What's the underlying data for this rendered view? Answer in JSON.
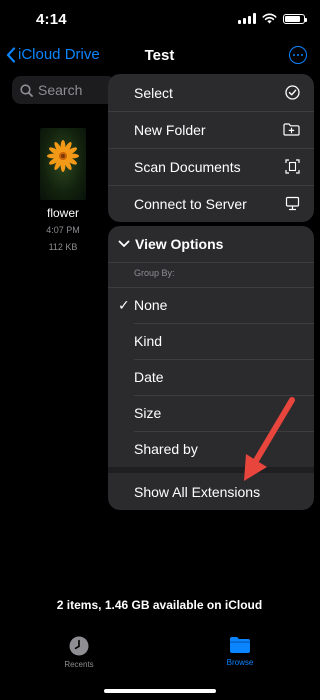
{
  "status_bar": {
    "time": "4:14"
  },
  "nav": {
    "back_label": "iCloud Drive",
    "title": "Test"
  },
  "search": {
    "placeholder": "Search"
  },
  "file": {
    "name": "flower",
    "time": "4:07 PM",
    "size": "112 KB"
  },
  "menu": {
    "actions": [
      {
        "label": "Select",
        "icon": "checkmark-circle-icon"
      },
      {
        "label": "New Folder",
        "icon": "folder-plus-icon"
      },
      {
        "label": "Scan Documents",
        "icon": "document-scan-icon"
      },
      {
        "label": "Connect to Server",
        "icon": "monitor-icon"
      }
    ],
    "view_options": {
      "title": "View Options",
      "group_by_label": "Group By:",
      "options": [
        "None",
        "Kind",
        "Date",
        "Size",
        "Shared by"
      ],
      "selected": "None",
      "show_extensions_label": "Show All Extensions"
    }
  },
  "footer": {
    "storage_text": "2 items, 1.46 GB available on iCloud"
  },
  "tabs": [
    {
      "label": "Recents",
      "icon": "clock-icon",
      "active": false
    },
    {
      "label": "Browse",
      "icon": "folder-icon",
      "active": true
    }
  ],
  "colors": {
    "accent": "#0a84ff",
    "annotation_arrow": "#e8453c",
    "menu_bg": "#2b2b2e"
  }
}
